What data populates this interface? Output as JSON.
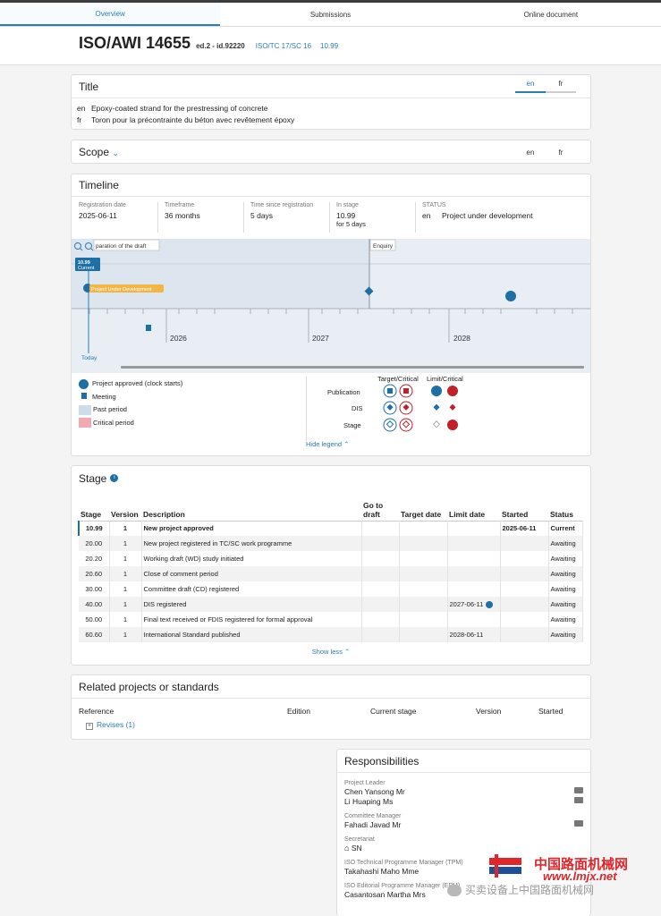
{
  "tabs": [
    "Overview",
    "Submissions",
    "Online document"
  ],
  "header": {
    "ref": "ISO/AWI 14655",
    "edition": "ed.2 - id.92220",
    "committee": "ISO/TC 17/SC 16",
    "stage": "10.99"
  },
  "title_card": {
    "heading": "Title",
    "langs": [
      "en",
      "fr"
    ],
    "rows": [
      {
        "lang": "en",
        "text": "Epoxy-coated strand for the prestressing of concrete"
      },
      {
        "lang": "fr",
        "text": "Toron pour la précontrainte du béton avec revêtement époxy"
      }
    ]
  },
  "scope_card": {
    "heading": "Scope",
    "langs": [
      "en",
      "fr"
    ]
  },
  "timeline": {
    "heading": "Timeline",
    "cols": [
      {
        "label": "Registration date",
        "value": "2025-06-11"
      },
      {
        "label": "Timeframe",
        "value": "36 months"
      },
      {
        "label": "Time since registration",
        "value": "5 days"
      },
      {
        "label": "In stage",
        "value": "10.99",
        "sub": "for 5 days"
      },
      {
        "label": "STATUS",
        "lang": "en",
        "value": "Project under development"
      }
    ],
    "phase1": "paration of the draft",
    "phase2": "Enquiry",
    "current_badge": "10.99",
    "current_label": "Current",
    "dev_label": "Project Under Development",
    "years": [
      "2026",
      "2027",
      "2028"
    ],
    "today": "Today",
    "legend": {
      "approved": "Project approved (clock starts)",
      "meeting": "Meeting",
      "past": "Past period",
      "critical": "Critical period",
      "col1": "Target/Critical",
      "col2": "Limit/Critical",
      "rows": [
        "Publication",
        "DIS",
        "Stage"
      ],
      "hide": "Hide legend"
    }
  },
  "stage_card": {
    "heading": "Stage",
    "headers": [
      "Stage",
      "Version",
      "Description",
      "Go to draft",
      "Target date",
      "Limit date",
      "Started",
      "Status"
    ],
    "rows": [
      {
        "stage": "10.99",
        "version": "1",
        "desc": "New project approved",
        "limit": "",
        "started": "2025-06-11",
        "status": "Current"
      },
      {
        "stage": "20.00",
        "version": "1",
        "desc": "New project registered in TC/SC work programme",
        "limit": "",
        "started": "",
        "status": "Awaiting"
      },
      {
        "stage": "20.20",
        "version": "1",
        "desc": "Working draft (WD) study initiated",
        "limit": "",
        "started": "",
        "status": "Awaiting"
      },
      {
        "stage": "20.60",
        "version": "1",
        "desc": "Close of comment period",
        "limit": "",
        "started": "",
        "status": "Awaiting"
      },
      {
        "stage": "30.00",
        "version": "1",
        "desc": "Committee draft (CD) registered",
        "limit": "",
        "started": "",
        "status": "Awaiting"
      },
      {
        "stage": "40.00",
        "version": "1",
        "desc": "DIS registered",
        "limit": "2027-06-11",
        "started": "",
        "status": "Awaiting"
      },
      {
        "stage": "50.00",
        "version": "1",
        "desc": "Final text received or FDIS registered for formal approval",
        "limit": "",
        "started": "",
        "status": "Awaiting"
      },
      {
        "stage": "60.60",
        "version": "1",
        "desc": "International Standard published",
        "limit": "2028-06-11",
        "started": "",
        "status": "Awaiting"
      }
    ],
    "show_less": "Show less"
  },
  "related": {
    "heading": "Related projects or standards",
    "headers": [
      "Reference",
      "Edition",
      "Current stage",
      "Version",
      "Started"
    ],
    "revises": "Revises (1)"
  },
  "resp": {
    "heading": "Responsibilities",
    "groups": [
      {
        "label": "Project Leader",
        "names": [
          "Chen Yansong Mr",
          "Li Huaping Ms"
        ]
      },
      {
        "label": "Committee Manager",
        "names": [
          "Fahadi Javad Mr"
        ]
      },
      {
        "label": "Secretariat",
        "names": [
          "SN"
        ]
      },
      {
        "label": "ISO Technical Programme Manager (TPM)",
        "names": [
          "Takahashi Maho Mme"
        ]
      },
      {
        "label": "ISO Editorial Programme Manager (EPM)",
        "names": [
          "Casantosan Martha Mrs"
        ]
      }
    ]
  },
  "watermark": {
    "site": "中国路面机械网",
    "url": "www.lmjx.net",
    "account": "买卖设备上中国路面机械网"
  }
}
